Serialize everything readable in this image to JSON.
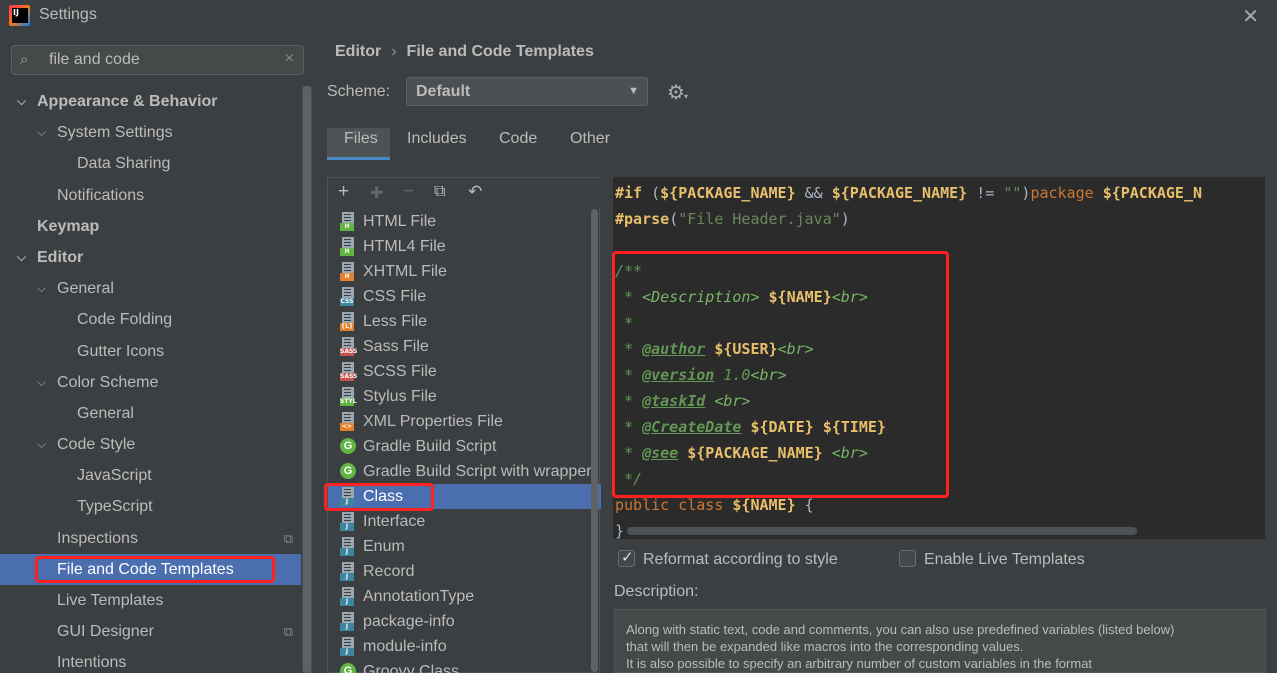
{
  "window": {
    "title": "Settings",
    "close": "✕"
  },
  "search": {
    "value": "file and code",
    "icon": "search-icon",
    "clear": "×"
  },
  "tree": [
    {
      "label": "Appearance & Behavior",
      "level": 0,
      "bold": true,
      "expanded": true
    },
    {
      "label": "System Settings",
      "level": 1,
      "expanded": true
    },
    {
      "label": "Data Sharing",
      "level": 2
    },
    {
      "label": "Notifications",
      "level": 1
    },
    {
      "label": "Keymap",
      "level": 0,
      "bold": true
    },
    {
      "label": "Editor",
      "level": 0,
      "bold": true,
      "expanded": true
    },
    {
      "label": "General",
      "level": 1,
      "expanded": true
    },
    {
      "label": "Code Folding",
      "level": 2
    },
    {
      "label": "Gutter Icons",
      "level": 2
    },
    {
      "label": "Color Scheme",
      "level": 1,
      "expanded": true
    },
    {
      "label": "General",
      "level": 2
    },
    {
      "label": "Code Style",
      "level": 1,
      "expanded": true
    },
    {
      "label": "JavaScript",
      "level": 2
    },
    {
      "label": "TypeScript",
      "level": 2
    },
    {
      "label": "Inspections",
      "level": 1,
      "copy": true
    },
    {
      "label": "File and Code Templates",
      "level": 1,
      "selected": true
    },
    {
      "label": "Live Templates",
      "level": 1
    },
    {
      "label": "GUI Designer",
      "level": 1,
      "copy": true
    },
    {
      "label": "Intentions",
      "level": 1
    }
  ],
  "breadcrumb": {
    "parent": "Editor",
    "sep": "›",
    "current": "File and Code Templates"
  },
  "scheme": {
    "label": "Scheme:",
    "value": "Default"
  },
  "tabs": [
    "Files",
    "Includes",
    "Code",
    "Other"
  ],
  "toolbar": {
    "add": "+",
    "add_child": "✚",
    "remove": "−",
    "copy": "⧉",
    "reset": "↶"
  },
  "templates": [
    {
      "label": "HTML File",
      "tag": "H",
      "color": "#62b543"
    },
    {
      "label": "HTML4 File",
      "tag": "H",
      "color": "#62b543"
    },
    {
      "label": "XHTML File",
      "tag": "H",
      "color": "#e57f2a"
    },
    {
      "label": "CSS File",
      "tag": "CSS",
      "color": "#3e86a0"
    },
    {
      "label": "Less File",
      "tag": "{L}",
      "color": "#e57f2a"
    },
    {
      "label": "Sass File",
      "tag": "SASS",
      "color": "#c75450"
    },
    {
      "label": "SCSS File",
      "tag": "SASS",
      "color": "#c75450"
    },
    {
      "label": "Stylus File",
      "tag": "STYL",
      "color": "#62b543"
    },
    {
      "label": "XML Properties File",
      "tag": "<>",
      "color": "#e57f2a"
    },
    {
      "label": "Gradle Build Script",
      "gradle": true
    },
    {
      "label": "Gradle Build Script with wrapper",
      "gradle": true
    },
    {
      "label": "Class",
      "tag": "J",
      "color": "#3e86a0",
      "selected": true
    },
    {
      "label": "Interface",
      "tag": "J",
      "color": "#3e86a0"
    },
    {
      "label": "Enum",
      "tag": "J",
      "color": "#3e86a0"
    },
    {
      "label": "Record",
      "tag": "J",
      "color": "#3e86a0"
    },
    {
      "label": "AnnotationType",
      "tag": "J",
      "color": "#3e86a0"
    },
    {
      "label": "package-info",
      "tag": "J",
      "color": "#3e86a0"
    },
    {
      "label": "module-info",
      "tag": "J",
      "color": "#3e86a0"
    },
    {
      "label": "Groovy Class",
      "gradle": true
    }
  ],
  "code": {
    "line1": {
      "if": "#if",
      "p1": " (",
      "v1": "${PACKAGE_NAME}",
      "and": " && ",
      "v2": "${PACKAGE_NAME}",
      "neq": " != ",
      "str": "\"\"",
      "p2": ")",
      "pkg": "package",
      "sp": " ",
      "v3": "${PACKAGE_N"
    },
    "line2": {
      "parse": "#parse",
      "p1": "(",
      "str": "\"File Header.java\"",
      "p2": ")"
    },
    "c_open": "/**",
    "c_desc_pre": " * ",
    "c_desc_tag": "<Description>",
    "c_desc_sp": " ",
    "c_desc_var": "${NAME}",
    "c_desc_br": "<br>",
    "c_star": " *",
    "c_author_tag": "@author",
    "c_author_var": "${USER}",
    "c_version_tag": "@version",
    "c_version_val": " 1.0",
    "c_taskid_tag": "@taskId",
    "c_created_tag": "@CreateDate",
    "c_date_var": "${DATE}",
    "c_time_var": "${TIME}",
    "c_see_tag": "@see",
    "c_see_var": "${PACKAGE_NAME}",
    "c_close": " */",
    "public": "public",
    "class": "class",
    "name_var": "${NAME}",
    "brace": "{",
    "close_brace": "}"
  },
  "options": {
    "reformat": "Reformat according to style",
    "live": "Enable Live Templates"
  },
  "description": {
    "label": "Description:",
    "lines": [
      "Along with static text, code and comments, you can also use predefined variables (listed below)",
      "that will then be expanded like macros into the corresponding values.",
      "It is also possible to specify an arbitrary number of custom variables in the format"
    ]
  }
}
